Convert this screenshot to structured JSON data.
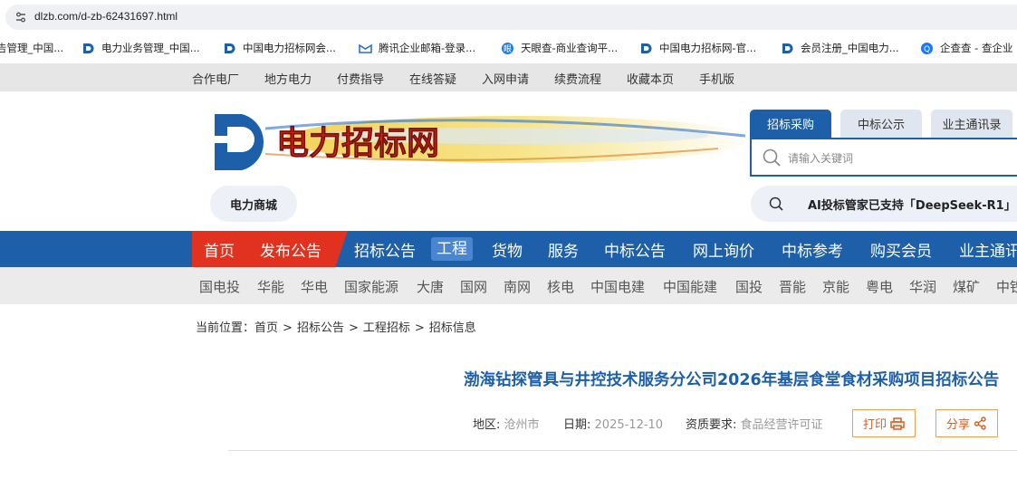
{
  "browser": {
    "url": "dlzb.com/d-zb-62431697.html",
    "bookmarks": [
      {
        "label": "告管理_中国...",
        "icon": "partial-icon"
      },
      {
        "label": "电力业务管理_中国...",
        "icon": "dlzb-logo-icon"
      },
      {
        "label": "中国电力招标网会...",
        "icon": "dlzb-logo-icon"
      },
      {
        "label": "腾讯企业邮箱-登录...",
        "icon": "tencent-mail-icon"
      },
      {
        "label": "天眼查-商业查询平...",
        "icon": "tianyancha-icon"
      },
      {
        "label": "中国电力招标网-官...",
        "icon": "dlzb-logo-icon"
      },
      {
        "label": "会员注册_中国电力...",
        "icon": "dlzb-logo-icon"
      },
      {
        "label": "企查查 - 查企业",
        "icon": "qichacha-icon"
      }
    ]
  },
  "top_nav": [
    "合作电厂",
    "地方电力",
    "付费指导",
    "在线答疑",
    "入网申请",
    "续费流程",
    "收藏本页",
    "手机版"
  ],
  "header": {
    "logo_text": "电力招标网",
    "tabs": [
      "招标采购",
      "中标公示",
      "业主通讯录"
    ],
    "search_placeholder": "请输入关键词",
    "mall_label": "电力商城",
    "ai_label": "AI投标管家已支持「DeepSeek-R1」"
  },
  "main_nav": [
    "首页",
    "发布公告",
    "招标公告",
    "工程",
    "货物",
    "服务",
    "中标公告",
    "网上询价",
    "中标参考",
    "购买会员",
    "业主通讯"
  ],
  "sub_nav": [
    "国电投",
    "华能",
    "华电",
    "国家能源",
    "大唐",
    "国网",
    "南网",
    "核电",
    "中国电建",
    "中国能建",
    "国投",
    "晋能",
    "京能",
    "粤电",
    "华润",
    "煤矿",
    "中铁"
  ],
  "breadcrumb": {
    "prefix": "当前位置：",
    "items": [
      "首页",
      "招标公告",
      "工程招标",
      "招标信息"
    ],
    "separator": ">"
  },
  "article": {
    "title": "渤海钻探管具与井控技术服务分公司2026年基层食堂食材采购项目招标公告",
    "region_label": "地区:",
    "region_value": "沧州市",
    "date_label": "日期:",
    "date_value": "2025-12-10",
    "qual_label": "资质要求:",
    "qual_value": "食品经营许可证",
    "print_label": "打印",
    "share_label": "分享"
  },
  "colors": {
    "brand_blue": "#1d5fa8",
    "brand_red": "#e0321e",
    "action_orange": "#e05a1a"
  }
}
